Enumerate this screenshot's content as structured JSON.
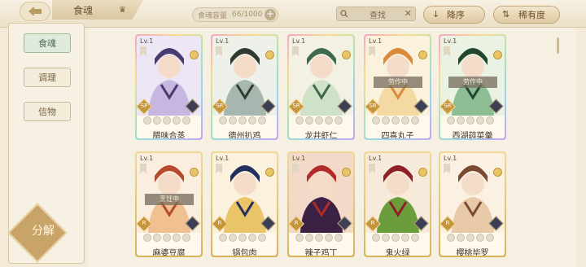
{
  "header": {
    "title": "食魂",
    "capacity_label": "食魂容量",
    "capacity_current": "66",
    "capacity_max": "/1000",
    "search_label": "查找",
    "sort_label": "降序",
    "rarity_label": "稀有度"
  },
  "sidebar": {
    "items": [
      {
        "label": "食魂",
        "active": true
      },
      {
        "label": "调理",
        "active": false
      },
      {
        "label": "信物",
        "active": false
      }
    ],
    "decompose_label": "分解"
  },
  "cards": [
    {
      "level": "Lv.1",
      "rarity": "SP",
      "name": "腊味合蒸",
      "stars": 0,
      "status": "",
      "rainbow": true,
      "palette": [
        "#4b3a6e",
        "#c7b6e0",
        "#ece6f5"
      ]
    },
    {
      "level": "Lv.1",
      "rarity": "SR",
      "name": "德州扒鸡",
      "stars": 0,
      "status": "",
      "rainbow": true,
      "palette": [
        "#2f3b2e",
        "#a8b6b0",
        "#eef0ea"
      ]
    },
    {
      "level": "Lv.1",
      "rarity": "SR",
      "name": "龙井虾仁",
      "stars": 0,
      "status": "",
      "rainbow": true,
      "palette": [
        "#3f6b4d",
        "#cfe2c8",
        "#f3f0e4"
      ]
    },
    {
      "level": "Lv.1",
      "rarity": "SR",
      "name": "四喜丸子",
      "stars": 0,
      "status": "劳作中",
      "rainbow": true,
      "palette": [
        "#d98a3c",
        "#f3d9a2",
        "#fbf2de"
      ]
    },
    {
      "level": "Lv.1",
      "rarity": "SR",
      "name": "西湖莼菜羹",
      "stars": 0,
      "status": "劳作中",
      "rainbow": true,
      "palette": [
        "#23452f",
        "#8dbd93",
        "#eaf2e3"
      ]
    },
    {
      "level": "Lv.1",
      "rarity": "R",
      "name": "麻婆豆腐",
      "stars": 0,
      "status": "烹饪中",
      "rainbow": false,
      "palette": [
        "#b54a2c",
        "#f0c090",
        "#fbeede"
      ]
    },
    {
      "level": "Lv.1",
      "rarity": "R",
      "name": "锅包肉",
      "stars": 0,
      "status": "",
      "rainbow": false,
      "palette": [
        "#23305e",
        "#e9c468",
        "#faf2de"
      ]
    },
    {
      "level": "Lv.1",
      "rarity": "R",
      "name": "辣子鸡丁",
      "stars": 0,
      "status": "",
      "rainbow": false,
      "palette": [
        "#b22a2a",
        "#3b2244",
        "#f3d9c8"
      ]
    },
    {
      "level": "Lv.1",
      "rarity": "R",
      "name": "鬼火绿",
      "stars": 0,
      "status": "",
      "rainbow": false,
      "palette": [
        "#8e1f27",
        "#6b9d3c",
        "#f6eadb"
      ]
    },
    {
      "level": "Lv.1",
      "rarity": "R",
      "name": "樱桃毕罗",
      "stars": 0,
      "status": "",
      "rainbow": false,
      "palette": [
        "#7a4a32",
        "#e8c9a8",
        "#fbf1e3"
      ]
    }
  ]
}
